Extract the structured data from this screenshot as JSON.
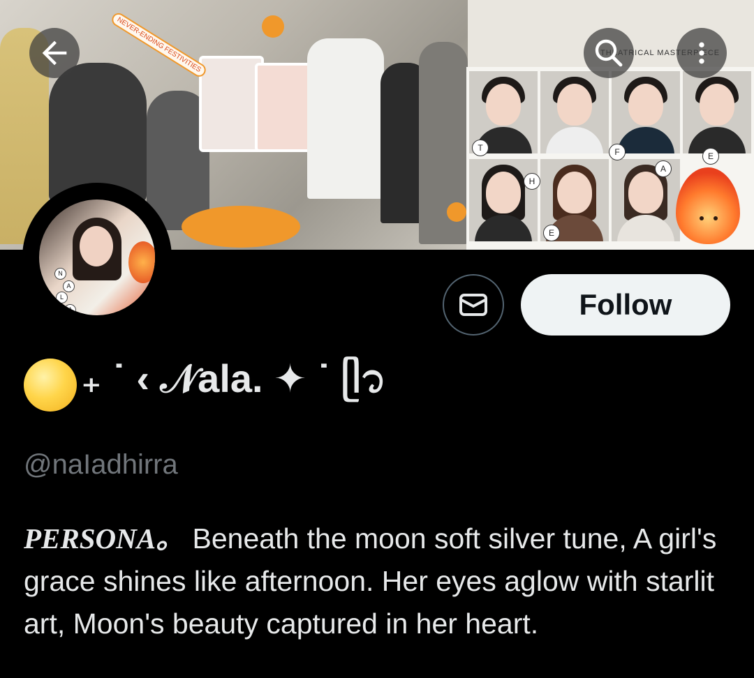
{
  "banner": {
    "sticker_text": "NEVER-ENDING FESTIVITIES",
    "corner_text": "THEATRICAL MASTERPIECE",
    "grid_letters": [
      "T",
      "F",
      "E",
      "H",
      "E",
      "A"
    ]
  },
  "nav": {
    "back_icon": "arrow-left-icon",
    "search_icon": "search-icon",
    "more_icon": "more-vertical-icon"
  },
  "avatar": {
    "letters": [
      "N",
      "A",
      "L",
      "A"
    ]
  },
  "actions": {
    "message_icon": "mail-icon",
    "follow_label": "Follow"
  },
  "profile": {
    "display_name": "₊ ˙ ‹ 𝒩ala. ✦ ˙ ᥫ᭡",
    "handle": "@naIadhirra",
    "bio_persona": "PERSONA。",
    "bio_text": " Beneath the moon soft silver tune, A girl's grace shines like afternoon. Her eyes aglow with starlit art, Moon's beauty captured in her heart."
  },
  "colors": {
    "background": "#000000",
    "text_primary": "#e7e9ea",
    "text_secondary": "#71767b",
    "follow_bg": "#eff3f4",
    "follow_text": "#0f1419",
    "outline": "#536471"
  }
}
